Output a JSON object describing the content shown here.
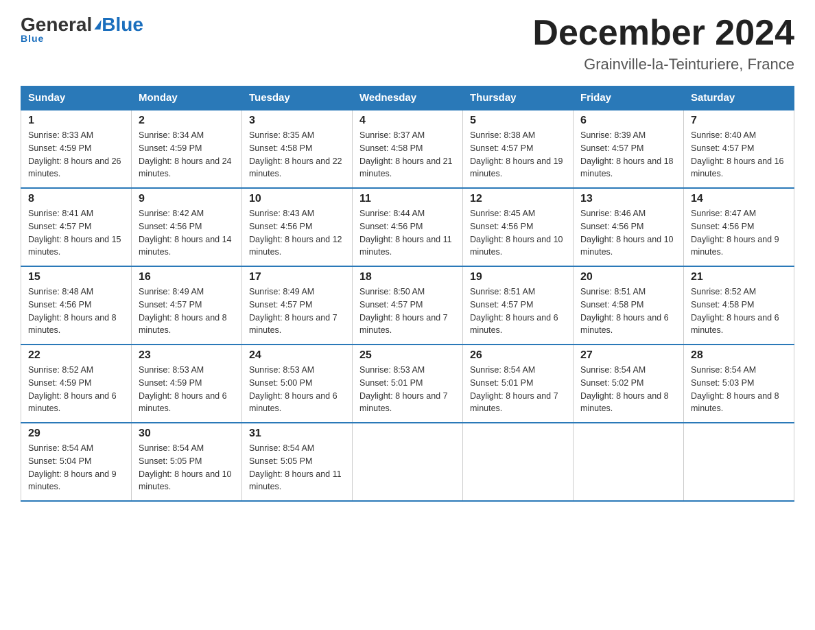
{
  "logo": {
    "general": "General",
    "blue": "Blue",
    "tagline": "Blue"
  },
  "header": {
    "month_year": "December 2024",
    "location": "Grainville-la-Teinturiere, France"
  },
  "days_of_week": [
    "Sunday",
    "Monday",
    "Tuesday",
    "Wednesday",
    "Thursday",
    "Friday",
    "Saturday"
  ],
  "weeks": [
    [
      {
        "day": "1",
        "sunrise": "Sunrise: 8:33 AM",
        "sunset": "Sunset: 4:59 PM",
        "daylight": "Daylight: 8 hours and 26 minutes."
      },
      {
        "day": "2",
        "sunrise": "Sunrise: 8:34 AM",
        "sunset": "Sunset: 4:59 PM",
        "daylight": "Daylight: 8 hours and 24 minutes."
      },
      {
        "day": "3",
        "sunrise": "Sunrise: 8:35 AM",
        "sunset": "Sunset: 4:58 PM",
        "daylight": "Daylight: 8 hours and 22 minutes."
      },
      {
        "day": "4",
        "sunrise": "Sunrise: 8:37 AM",
        "sunset": "Sunset: 4:58 PM",
        "daylight": "Daylight: 8 hours and 21 minutes."
      },
      {
        "day": "5",
        "sunrise": "Sunrise: 8:38 AM",
        "sunset": "Sunset: 4:57 PM",
        "daylight": "Daylight: 8 hours and 19 minutes."
      },
      {
        "day": "6",
        "sunrise": "Sunrise: 8:39 AM",
        "sunset": "Sunset: 4:57 PM",
        "daylight": "Daylight: 8 hours and 18 minutes."
      },
      {
        "day": "7",
        "sunrise": "Sunrise: 8:40 AM",
        "sunset": "Sunset: 4:57 PM",
        "daylight": "Daylight: 8 hours and 16 minutes."
      }
    ],
    [
      {
        "day": "8",
        "sunrise": "Sunrise: 8:41 AM",
        "sunset": "Sunset: 4:57 PM",
        "daylight": "Daylight: 8 hours and 15 minutes."
      },
      {
        "day": "9",
        "sunrise": "Sunrise: 8:42 AM",
        "sunset": "Sunset: 4:56 PM",
        "daylight": "Daylight: 8 hours and 14 minutes."
      },
      {
        "day": "10",
        "sunrise": "Sunrise: 8:43 AM",
        "sunset": "Sunset: 4:56 PM",
        "daylight": "Daylight: 8 hours and 12 minutes."
      },
      {
        "day": "11",
        "sunrise": "Sunrise: 8:44 AM",
        "sunset": "Sunset: 4:56 PM",
        "daylight": "Daylight: 8 hours and 11 minutes."
      },
      {
        "day": "12",
        "sunrise": "Sunrise: 8:45 AM",
        "sunset": "Sunset: 4:56 PM",
        "daylight": "Daylight: 8 hours and 10 minutes."
      },
      {
        "day": "13",
        "sunrise": "Sunrise: 8:46 AM",
        "sunset": "Sunset: 4:56 PM",
        "daylight": "Daylight: 8 hours and 10 minutes."
      },
      {
        "day": "14",
        "sunrise": "Sunrise: 8:47 AM",
        "sunset": "Sunset: 4:56 PM",
        "daylight": "Daylight: 8 hours and 9 minutes."
      }
    ],
    [
      {
        "day": "15",
        "sunrise": "Sunrise: 8:48 AM",
        "sunset": "Sunset: 4:56 PM",
        "daylight": "Daylight: 8 hours and 8 minutes."
      },
      {
        "day": "16",
        "sunrise": "Sunrise: 8:49 AM",
        "sunset": "Sunset: 4:57 PM",
        "daylight": "Daylight: 8 hours and 8 minutes."
      },
      {
        "day": "17",
        "sunrise": "Sunrise: 8:49 AM",
        "sunset": "Sunset: 4:57 PM",
        "daylight": "Daylight: 8 hours and 7 minutes."
      },
      {
        "day": "18",
        "sunrise": "Sunrise: 8:50 AM",
        "sunset": "Sunset: 4:57 PM",
        "daylight": "Daylight: 8 hours and 7 minutes."
      },
      {
        "day": "19",
        "sunrise": "Sunrise: 8:51 AM",
        "sunset": "Sunset: 4:57 PM",
        "daylight": "Daylight: 8 hours and 6 minutes."
      },
      {
        "day": "20",
        "sunrise": "Sunrise: 8:51 AM",
        "sunset": "Sunset: 4:58 PM",
        "daylight": "Daylight: 8 hours and 6 minutes."
      },
      {
        "day": "21",
        "sunrise": "Sunrise: 8:52 AM",
        "sunset": "Sunset: 4:58 PM",
        "daylight": "Daylight: 8 hours and 6 minutes."
      }
    ],
    [
      {
        "day": "22",
        "sunrise": "Sunrise: 8:52 AM",
        "sunset": "Sunset: 4:59 PM",
        "daylight": "Daylight: 8 hours and 6 minutes."
      },
      {
        "day": "23",
        "sunrise": "Sunrise: 8:53 AM",
        "sunset": "Sunset: 4:59 PM",
        "daylight": "Daylight: 8 hours and 6 minutes."
      },
      {
        "day": "24",
        "sunrise": "Sunrise: 8:53 AM",
        "sunset": "Sunset: 5:00 PM",
        "daylight": "Daylight: 8 hours and 6 minutes."
      },
      {
        "day": "25",
        "sunrise": "Sunrise: 8:53 AM",
        "sunset": "Sunset: 5:01 PM",
        "daylight": "Daylight: 8 hours and 7 minutes."
      },
      {
        "day": "26",
        "sunrise": "Sunrise: 8:54 AM",
        "sunset": "Sunset: 5:01 PM",
        "daylight": "Daylight: 8 hours and 7 minutes."
      },
      {
        "day": "27",
        "sunrise": "Sunrise: 8:54 AM",
        "sunset": "Sunset: 5:02 PM",
        "daylight": "Daylight: 8 hours and 8 minutes."
      },
      {
        "day": "28",
        "sunrise": "Sunrise: 8:54 AM",
        "sunset": "Sunset: 5:03 PM",
        "daylight": "Daylight: 8 hours and 8 minutes."
      }
    ],
    [
      {
        "day": "29",
        "sunrise": "Sunrise: 8:54 AM",
        "sunset": "Sunset: 5:04 PM",
        "daylight": "Daylight: 8 hours and 9 minutes."
      },
      {
        "day": "30",
        "sunrise": "Sunrise: 8:54 AM",
        "sunset": "Sunset: 5:05 PM",
        "daylight": "Daylight: 8 hours and 10 minutes."
      },
      {
        "day": "31",
        "sunrise": "Sunrise: 8:54 AM",
        "sunset": "Sunset: 5:05 PM",
        "daylight": "Daylight: 8 hours and 11 minutes."
      },
      null,
      null,
      null,
      null
    ]
  ]
}
